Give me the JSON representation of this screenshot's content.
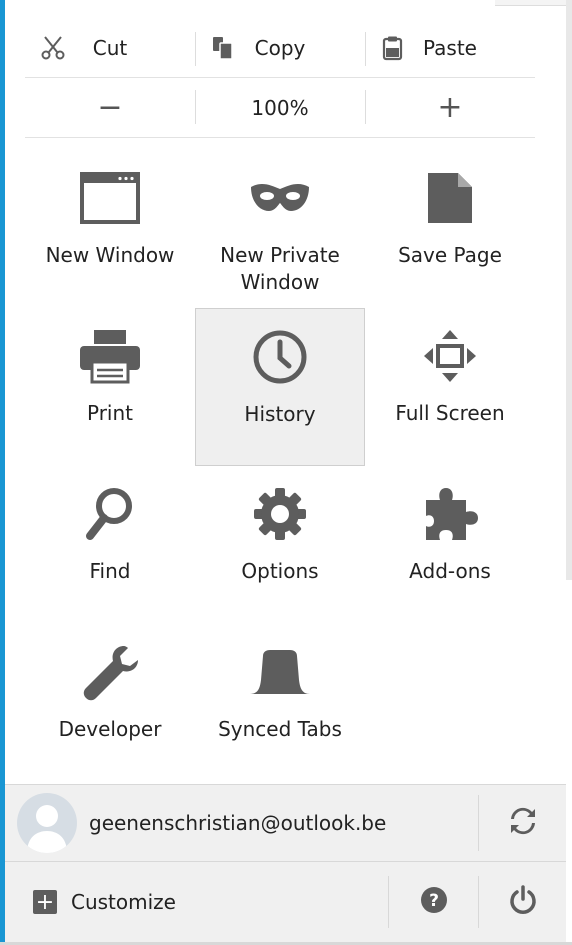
{
  "edit": {
    "cut_label": "Cut",
    "copy_label": "Copy",
    "paste_label": "Paste"
  },
  "zoom": {
    "decrease_label": "−",
    "level": "100%",
    "increase_label": "+"
  },
  "tiles": [
    {
      "label": "New Window",
      "icon": "new-window-icon"
    },
    {
      "label": "New Private\nWindow",
      "icon": "mask-icon"
    },
    {
      "label": "Save Page",
      "icon": "page-icon"
    },
    {
      "label": "Print",
      "icon": "printer-icon"
    },
    {
      "label": "History",
      "icon": "clock-icon"
    },
    {
      "label": "Full Screen",
      "icon": "fullscreen-icon"
    },
    {
      "label": "Find",
      "icon": "magnifier-icon"
    },
    {
      "label": "Options",
      "icon": "gear-icon"
    },
    {
      "label": "Add-ons",
      "icon": "puzzle-icon"
    },
    {
      "label": "Developer",
      "icon": "wrench-icon"
    },
    {
      "label": "Synced Tabs",
      "icon": "synced-tabs-icon"
    }
  ],
  "account": {
    "email": "geenenschristian@outlook.be"
  },
  "footer": {
    "customize_label": "Customize"
  },
  "colors": {
    "accent": "#1996d3",
    "icon_gray": "#5d5d5d",
    "footer_bg": "#f0f0f0",
    "active_tile_bg": "#efefef"
  }
}
